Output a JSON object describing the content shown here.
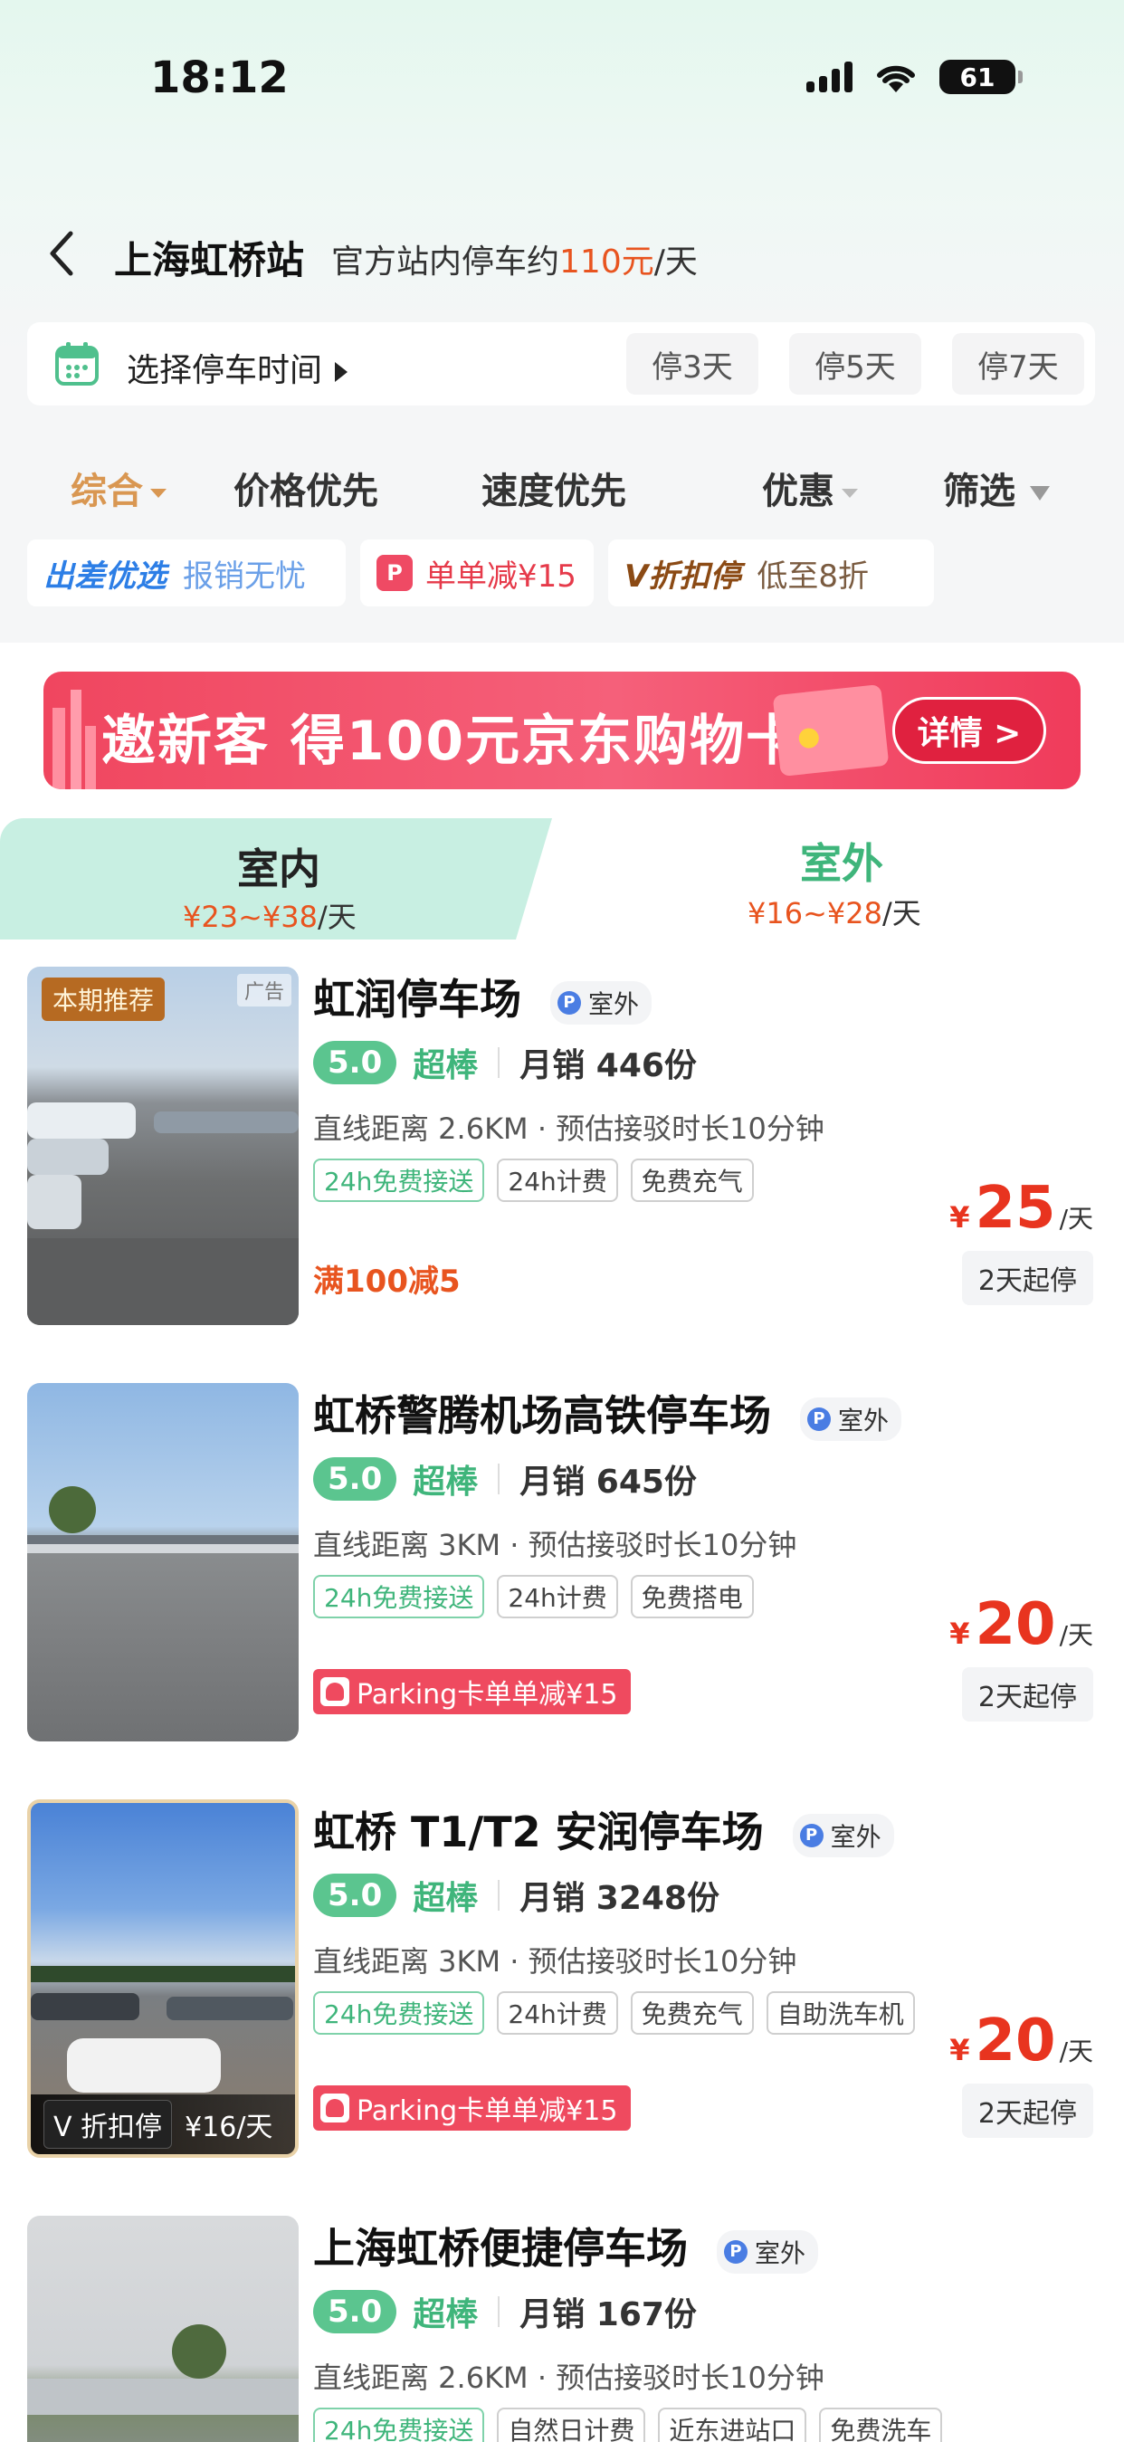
{
  "status_bar": {
    "time": "18:12",
    "battery": "61"
  },
  "header": {
    "title": "上海虹桥站",
    "subtitle_prefix": "官方站内停车约",
    "price": "110元",
    "subtitle_suffix": "/天"
  },
  "time_selector": {
    "label": "选择停车时间",
    "options": [
      "停3天",
      "停5天",
      "停7天"
    ]
  },
  "sort_tabs": [
    {
      "label": "综合"
    },
    {
      "label": "价格优先"
    },
    {
      "label": "速度优先"
    },
    {
      "label": "优惠"
    },
    {
      "label": "筛选"
    }
  ],
  "promo_chips": [
    {
      "brand": "出差优选",
      "text": "报销无忧"
    },
    {
      "text": "单单减¥15"
    },
    {
      "brand": "V折扣停",
      "text": "低至8折"
    }
  ],
  "banner": {
    "text": "邀新客 得100元京东购物卡",
    "button": "详情 >"
  },
  "location_tabs": [
    {
      "name": "室内",
      "price_from": "¥23",
      "tilde": "~",
      "price_to": "¥38",
      "unit": "/天"
    },
    {
      "name": "室外",
      "price_from": "¥16",
      "tilde": "~",
      "price_to": "¥28",
      "unit": "/天"
    }
  ],
  "listings": [
    {
      "name": "虹润停车场",
      "type_badge": "室外",
      "score": "5.0",
      "grade": "超棒",
      "sales": "月销 446份",
      "distance": "直线距离 2.6KM · 预估接驳时长10分钟",
      "tags": [
        "24h免费接送",
        "24h计费",
        "免费充气"
      ],
      "price_currency": "¥",
      "price": "25",
      "price_unit": "/天",
      "min_days": "2天起停",
      "promo": "满100减5",
      "photo_badge": "本期推荐",
      "ad_label": "广告"
    },
    {
      "name": "虹桥警腾机场高铁停车场",
      "type_badge": "室外",
      "score": "5.0",
      "grade": "超棒",
      "sales": "月销 645份",
      "distance": "直线距离 3KM · 预估接驳时长10分钟",
      "tags": [
        "24h免费接送",
        "24h计费",
        "免费搭电"
      ],
      "price_currency": "¥",
      "price": "20",
      "price_unit": "/天",
      "min_days": "2天起停",
      "promo": "Parking卡单单减¥15"
    },
    {
      "name": "虹桥 T1/T2 安润停车场",
      "type_badge": "室外",
      "score": "5.0",
      "grade": "超棒",
      "sales": "月销 3248份",
      "distance": "直线距离 3KM · 预估接驳时长10分钟",
      "tags": [
        "24h免费接送",
        "24h计费",
        "免费充气",
        "自助洗车机"
      ],
      "price_currency": "¥",
      "price": "20",
      "price_unit": "/天",
      "min_days": "2天起停",
      "promo": "Parking卡单单减¥15",
      "photo_discount_label": "V 折扣停",
      "photo_discount_price": "¥16/天"
    },
    {
      "name": "上海虹桥便捷停车场",
      "type_badge": "室外",
      "score": "5.0",
      "grade": "超棒",
      "sales": "月销 167份",
      "distance": "直线距离 2.6KM · 预估接驳时长10分钟",
      "tags": [
        "24h免费接送",
        "自然日计费",
        "近东进站口",
        "免费洗车"
      ]
    }
  ],
  "colors": {
    "accent_orange": "#e8541f",
    "green": "#3fb57b",
    "sort_active": "#d99752"
  }
}
